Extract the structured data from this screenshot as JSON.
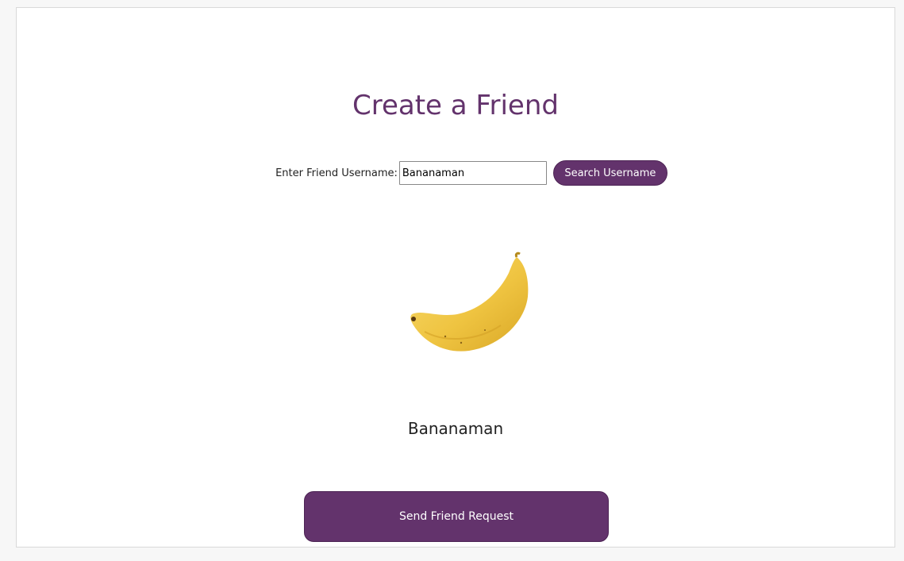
{
  "page": {
    "title": "Create a Friend"
  },
  "search": {
    "label": "Enter Friend Username:",
    "value": "Bananaman",
    "button_label": "Search Username"
  },
  "result": {
    "avatar_icon": "banana-icon",
    "name": "Bananaman"
  },
  "actions": {
    "send_request_label": "Send Friend Request"
  },
  "colors": {
    "accent": "#63336c",
    "banana": "#f2c94c"
  }
}
